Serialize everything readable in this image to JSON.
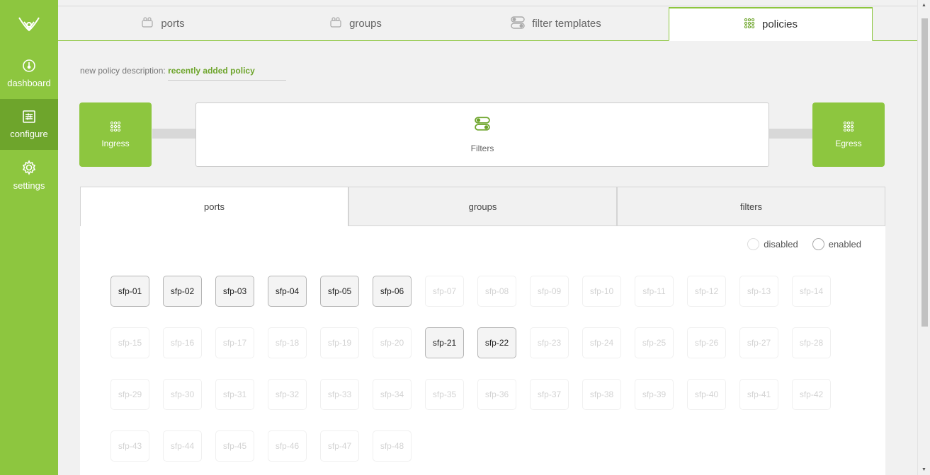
{
  "sidebar": {
    "logo_icon": "leaf-logo-icon",
    "items": [
      {
        "label": "dashboard",
        "icon": "dashboard-icon",
        "active": false
      },
      {
        "label": "configure",
        "icon": "sliders-icon",
        "active": true
      },
      {
        "label": "settings",
        "icon": "gear-icon",
        "active": false
      }
    ]
  },
  "top_tabs": [
    {
      "label": "ports",
      "icon": "ports-icon",
      "active": false
    },
    {
      "label": "groups",
      "icon": "groups-icon",
      "active": false
    },
    {
      "label": "filter templates",
      "icon": "toggle-icon",
      "active": false
    },
    {
      "label": "policies",
      "icon": "grid-dots-icon",
      "active": true
    }
  ],
  "policy": {
    "desc_label": "new policy description: ",
    "desc_value": "recently added policy"
  },
  "pipeline": {
    "ingress": "Ingress",
    "filters": "Filters",
    "egress": "Egress"
  },
  "panel": {
    "tabs": [
      "ports",
      "groups",
      "filters"
    ],
    "legend": {
      "disabled": "disabled",
      "enabled": "enabled"
    },
    "ports": [
      {
        "name": "sfp-01",
        "on": true
      },
      {
        "name": "sfp-02",
        "on": true
      },
      {
        "name": "sfp-03",
        "on": true
      },
      {
        "name": "sfp-04",
        "on": true
      },
      {
        "name": "sfp-05",
        "on": true
      },
      {
        "name": "sfp-06",
        "on": true
      },
      {
        "name": "sfp-07",
        "on": false
      },
      {
        "name": "sfp-08",
        "on": false
      },
      {
        "name": "sfp-09",
        "on": false
      },
      {
        "name": "sfp-10",
        "on": false
      },
      {
        "name": "sfp-11",
        "on": false
      },
      {
        "name": "sfp-12",
        "on": false
      },
      {
        "name": "sfp-13",
        "on": false
      },
      {
        "name": "sfp-14",
        "on": false
      },
      {
        "name": "sfp-15",
        "on": false
      },
      {
        "name": "sfp-16",
        "on": false
      },
      {
        "name": "sfp-17",
        "on": false
      },
      {
        "name": "sfp-18",
        "on": false
      },
      {
        "name": "sfp-19",
        "on": false
      },
      {
        "name": "sfp-20",
        "on": false
      },
      {
        "name": "sfp-21",
        "on": true
      },
      {
        "name": "sfp-22",
        "on": true
      },
      {
        "name": "sfp-23",
        "on": false
      },
      {
        "name": "sfp-24",
        "on": false
      },
      {
        "name": "sfp-25",
        "on": false
      },
      {
        "name": "sfp-26",
        "on": false
      },
      {
        "name": "sfp-27",
        "on": false
      },
      {
        "name": "sfp-28",
        "on": false
      },
      {
        "name": "sfp-29",
        "on": false
      },
      {
        "name": "sfp-30",
        "on": false
      },
      {
        "name": "sfp-31",
        "on": false
      },
      {
        "name": "sfp-32",
        "on": false
      },
      {
        "name": "sfp-33",
        "on": false
      },
      {
        "name": "sfp-34",
        "on": false
      },
      {
        "name": "sfp-35",
        "on": false
      },
      {
        "name": "sfp-36",
        "on": false
      },
      {
        "name": "sfp-37",
        "on": false
      },
      {
        "name": "sfp-38",
        "on": false
      },
      {
        "name": "sfp-39",
        "on": false
      },
      {
        "name": "sfp-40",
        "on": false
      },
      {
        "name": "sfp-41",
        "on": false
      },
      {
        "name": "sfp-42",
        "on": false
      },
      {
        "name": "sfp-43",
        "on": false
      },
      {
        "name": "sfp-44",
        "on": false
      },
      {
        "name": "sfp-45",
        "on": false
      },
      {
        "name": "sfp-46",
        "on": false
      },
      {
        "name": "sfp-47",
        "on": false
      },
      {
        "name": "sfp-48",
        "on": false
      }
    ]
  }
}
